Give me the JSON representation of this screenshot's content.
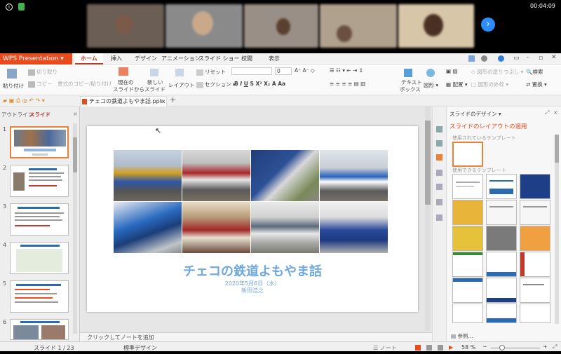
{
  "call": {
    "timer": "00:04:09"
  },
  "app": {
    "name": "WPS Presentation",
    "tabs": [
      "ホーム",
      "挿入",
      "デザイン",
      "アニメーション",
      "スライド ショー",
      "校閲",
      "表示"
    ]
  },
  "ribbon": {
    "paste": "貼り付け",
    "cut": "切り取り",
    "copy": "コピー",
    "format_copy": "書式のコピー/貼り付け",
    "from_current": "現在の",
    "from_current2": "スライドから",
    "new_slide": "新しい",
    "new_slide2": "スライド",
    "layout": "レイアウト",
    "reset": "リセット",
    "section": "セクション",
    "font_size": "0",
    "textbox": "テキスト",
    "textbox2": "ボックス",
    "shape": "図形",
    "arrange": "配置",
    "shape_fill": "図形の塗りつぶし",
    "shape_outline": "図形の外枠",
    "find": "検索",
    "replace": "置換"
  },
  "document": {
    "filename": "チェコの鉄道よもやま話.pptx"
  },
  "leftpanel": {
    "tab_outline": "アウトライン",
    "tab_slide": "スライド"
  },
  "slides_thumbs": [
    "1",
    "2",
    "3",
    "4",
    "5",
    "6"
  ],
  "slide": {
    "title": "チェコの鉄道よもやま話",
    "date": "2020年5月6日（水）",
    "author": "新田浩之"
  },
  "notes": {
    "placeholder": "クリックしてノートを追加"
  },
  "rightpanel": {
    "title": "スライドのデザイン",
    "heading": "スライドのレイアウトの適用",
    "used": "使用されているテンプレート",
    "available": "使用できるテンプレート",
    "browse": "参照..."
  },
  "status": {
    "slide_count": "スライド 1 / 23",
    "design": "標準デザイン",
    "notes": "ノート",
    "zoom": "58 %"
  },
  "colors": {
    "accent": "#e84c1e",
    "title_blue": "#6fa8dc"
  }
}
